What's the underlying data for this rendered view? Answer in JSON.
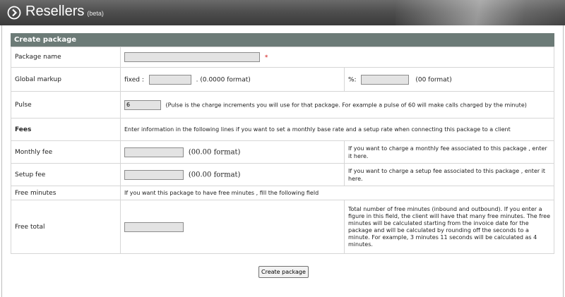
{
  "header": {
    "title": "Resellers",
    "beta": "(beta)",
    "icon": "circle-arrow-right-icon"
  },
  "panel": {
    "title": "Create package"
  },
  "rows": {
    "package_name": {
      "label": "Package name",
      "value": "",
      "required_mark": "*"
    },
    "global_markup": {
      "label": "Global markup",
      "fixed_label": "fixed :",
      "fixed_value": "",
      "fixed_format": ". (0.0000 format)",
      "percent_label": "%:",
      "percent_value": "",
      "percent_format": "(00 format)"
    },
    "pulse": {
      "label": "Pulse",
      "value": "6",
      "help": "(Pulse is the charge increments you will use for that package. For example a pulse of 60 will make calls charged by the minute)"
    },
    "fees": {
      "label": "Fees",
      "help": "Enter information in the following lines if you want to set a monthly base rate and a setup rate when connecting this package to a client"
    },
    "monthly_fee": {
      "label": "Monthly fee",
      "value": "",
      "format": "(00.00 format)",
      "help": "If you want to charge a monthly fee associated to this package , enter it here."
    },
    "setup_fee": {
      "label": "Setup fee",
      "value": "",
      "format": "(00.00 format)",
      "help": "If you want to charge a setup fee associated to this package , enter it here."
    },
    "free_minutes": {
      "label": "Free minutes",
      "help": "If you want this package to have free minutes , fill the following field"
    },
    "free_total": {
      "label": "Free total",
      "value": "",
      "help": "Total number of free minutes (inbound and outbound). If you enter a figure in this field, the client will have that many free minutes. The free minutes will be calculated starting from the invoice date for the package and will be calculated by rounding off the seconds to a minute. For example, 3 minutes 11 seconds will be calculated as 4 minutes."
    }
  },
  "submit": {
    "label": "Create package"
  }
}
